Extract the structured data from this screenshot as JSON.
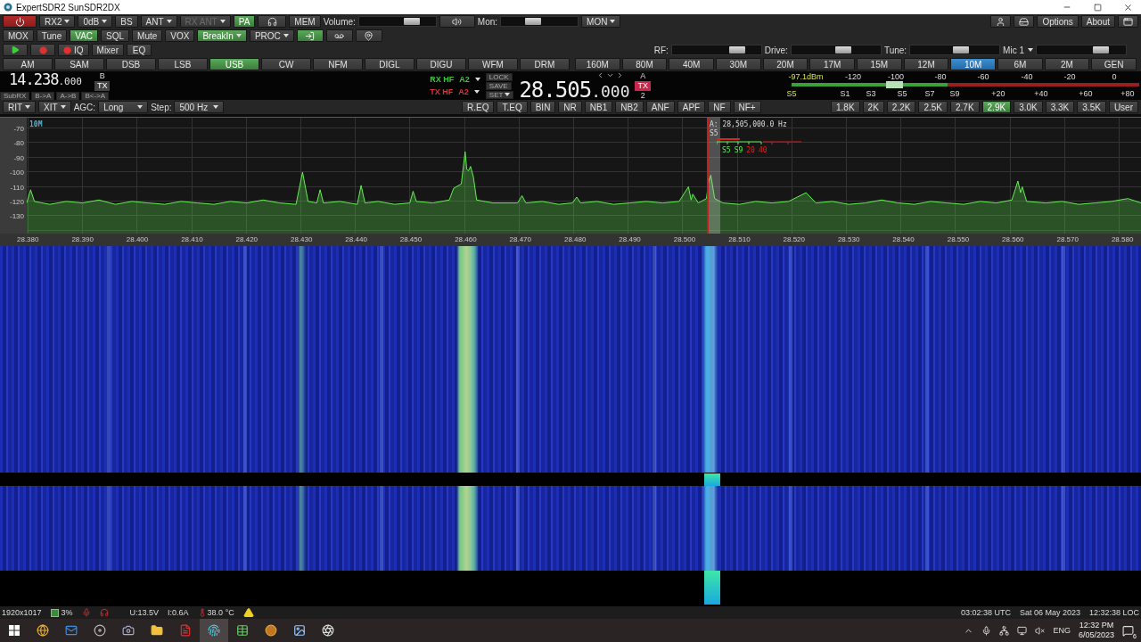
{
  "window": {
    "title": "ExpertSDR2 SunSDR2DX"
  },
  "top_row": [
    {
      "kind": "power"
    },
    {
      "kind": "text",
      "label": "RX2",
      "dropdown": true,
      "selected": false,
      "disabled": false
    },
    {
      "kind": "text",
      "label": "0dB",
      "dropdown": true,
      "selected": false,
      "disabled": false
    },
    {
      "kind": "text",
      "label": "BS",
      "dropdown": false,
      "selected": false,
      "disabled": false
    },
    {
      "kind": "text",
      "label": "ANT",
      "dropdown": true,
      "selected": false,
      "disabled": false
    },
    {
      "kind": "text",
      "label": "RX ANT",
      "dropdown": true,
      "selected": false,
      "disabled": true
    },
    {
      "kind": "text",
      "label": "PA",
      "dropdown": false,
      "selected": true,
      "disabled": false
    },
    {
      "kind": "headphones",
      "selected": false,
      "disabled": false
    },
    {
      "kind": "text",
      "label": "MEM",
      "dropdown": false,
      "selected": false,
      "disabled": false
    },
    {
      "kind": "slider",
      "label": "Volume:",
      "level": 0.74
    },
    {
      "kind": "speaker",
      "selected": false,
      "disabled": false
    },
    {
      "kind": "slider",
      "label": "Mon:",
      "level": 0.4
    },
    {
      "kind": "text",
      "label": "MON",
      "dropdown": true,
      "selected": false,
      "disabled": false
    }
  ],
  "top_row_right": [
    {
      "kind": "user"
    },
    {
      "kind": "drive"
    },
    {
      "kind": "text",
      "label": "Options"
    },
    {
      "kind": "text",
      "label": "About"
    },
    {
      "kind": "window"
    }
  ],
  "second_row": [
    {
      "kind": "text",
      "label": "MOX",
      "dropdown": false,
      "selected": false
    },
    {
      "kind": "text",
      "label": "Tune",
      "dropdown": false,
      "selected": false
    },
    {
      "kind": "text",
      "label": "VAC",
      "dropdown": false,
      "selected": true
    },
    {
      "kind": "text",
      "label": "SQL",
      "dropdown": false,
      "selected": false
    },
    {
      "kind": "text",
      "label": "Mute",
      "dropdown": false,
      "selected": false
    },
    {
      "kind": "text",
      "label": "VOX",
      "dropdown": false,
      "selected": false
    },
    {
      "kind": "text",
      "label": "BreakIn",
      "dropdown": true,
      "selected": true
    },
    {
      "kind": "text",
      "label": "PROC",
      "dropdown": true,
      "selected": false
    },
    {
      "kind": "return",
      "selected": true
    },
    {
      "kind": "tape",
      "selected": false
    },
    {
      "kind": "pin",
      "selected": false
    }
  ],
  "third_row": [
    {
      "kind": "play",
      "selected": false
    },
    {
      "kind": "record",
      "selected": false
    },
    {
      "kind": "record-text",
      "label": "IQ",
      "selected": false
    },
    {
      "kind": "text",
      "label": "Mixer",
      "selected": false
    },
    {
      "kind": "text",
      "label": "EQ",
      "selected": false
    }
  ],
  "level_controls": [
    {
      "label": "RF:",
      "level": 0.78
    },
    {
      "label": "Drive:",
      "level": 0.6
    },
    {
      "label": "Tune:",
      "level": 0.59
    },
    {
      "label": "Mic 1",
      "dropdown": true,
      "level": 0.77
    }
  ],
  "modes": [
    {
      "label": "AM",
      "selected": false
    },
    {
      "label": "SAM",
      "selected": false
    },
    {
      "label": "DSB",
      "selected": false
    },
    {
      "label": "LSB",
      "selected": false
    },
    {
      "label": "USB",
      "selected": true
    },
    {
      "label": "CW",
      "selected": false
    },
    {
      "label": "NFM",
      "selected": false
    },
    {
      "label": "DIGL",
      "selected": false
    },
    {
      "label": "DIGU",
      "selected": false
    },
    {
      "label": "WFM",
      "selected": false
    },
    {
      "label": "DRM",
      "selected": false
    }
  ],
  "bands": [
    {
      "label": "160M",
      "selected": false
    },
    {
      "label": "80M",
      "selected": false
    },
    {
      "label": "40M",
      "selected": false
    },
    {
      "label": "30M",
      "selected": false
    },
    {
      "label": "20M",
      "selected": false
    },
    {
      "label": "17M",
      "selected": false
    },
    {
      "label": "15M",
      "selected": false
    },
    {
      "label": "12M",
      "selected": false
    },
    {
      "label": "10M",
      "selected": true
    },
    {
      "label": "6M",
      "selected": false
    },
    {
      "label": "2M",
      "selected": false
    },
    {
      "label": "GEN",
      "selected": false
    }
  ],
  "vfo_b": {
    "frequency": "14.238",
    "frequency_fine": ".000",
    "label": "B",
    "tx": "TX",
    "buttons": [
      "SubRX",
      "B->A",
      "A->B",
      "B<->A"
    ]
  },
  "rx_path": [
    {
      "label": "RX HF",
      "antenna": "A2",
      "color": "#3ec43e"
    },
    {
      "label": "TX HF",
      "antenna": "A2",
      "color": "#e0303a"
    }
  ],
  "memory_buttons": [
    {
      "label": "LOCK",
      "dropdown": false
    },
    {
      "label": "SAVE",
      "dropdown": false
    },
    {
      "label": "SET",
      "dropdown": true
    }
  ],
  "vfo_a": {
    "frequency": "28.505",
    "frequency_fine": ".000",
    "label": "A",
    "tx": "TX",
    "receiver": "2"
  },
  "s_meter": {
    "reading": "-97.1dBm",
    "s_reading": "S5",
    "level": 0.32,
    "dbm_scale": [
      "-120",
      "-100",
      "-80",
      "-60",
      "-40",
      "-20",
      "0"
    ],
    "s_scale": [
      "S1",
      "S3",
      "S5",
      "S7",
      "S9",
      "+20",
      "+40",
      "+60",
      "+80"
    ]
  },
  "receiver_controls": [
    {
      "kind": "dropdown",
      "label": "RIT"
    },
    {
      "kind": "dropdown",
      "label": "XIT"
    },
    {
      "kind": "select",
      "label": "AGC:",
      "value": "Long"
    },
    {
      "kind": "select",
      "label": "Step:",
      "value": "500 Hz"
    }
  ],
  "dsp_buttons": [
    {
      "label": "R.EQ",
      "selected": false
    },
    {
      "label": "T.EQ",
      "selected": false
    },
    {
      "label": "BIN",
      "selected": false
    },
    {
      "label": "NR",
      "selected": false
    },
    {
      "label": "NB1",
      "selected": false
    },
    {
      "label": "NB2",
      "selected": false
    },
    {
      "label": "ANF",
      "selected": false
    },
    {
      "label": "APF",
      "selected": false
    },
    {
      "label": "NF",
      "selected": false
    },
    {
      "label": "NF+",
      "selected": false
    }
  ],
  "filters": [
    {
      "label": "1.8K",
      "selected": false
    },
    {
      "label": "2K",
      "selected": false
    },
    {
      "label": "2.2K",
      "selected": false
    },
    {
      "label": "2.5K",
      "selected": false
    },
    {
      "label": "2.7K",
      "selected": false
    },
    {
      "label": "2.9K",
      "selected": true
    },
    {
      "label": "3.0K",
      "selected": false
    },
    {
      "label": "3.3K",
      "selected": false
    },
    {
      "label": "3.5K",
      "selected": false
    },
    {
      "label": "User",
      "selected": false
    }
  ],
  "spectrum": {
    "band_label": "10M",
    "chart_data": {
      "type": "area",
      "xlim": [
        28.3798,
        28.5834
      ],
      "ylim": [
        -142,
        -62.7
      ],
      "ref_lines": [
        {
          "axis": "x",
          "value": 28.5043,
          "color": "#c02020"
        }
      ],
      "bands": [
        {
          "axis": "x",
          "from": 28.5044,
          "to": 28.5066,
          "color": "#bebebe"
        }
      ],
      "yticks": [
        -70,
        -80,
        -90,
        -100,
        -110,
        -120,
        -130
      ],
      "xticks": [
        {
          "value": 28.38,
          "label": "28.380"
        },
        {
          "value": 28.39,
          "label": "28.390"
        },
        {
          "value": 28.4,
          "label": "28.400"
        },
        {
          "value": 28.41,
          "label": "28.410"
        },
        {
          "value": 28.42,
          "label": "28.420"
        },
        {
          "value": 28.43,
          "label": "28.430"
        },
        {
          "value": 28.44,
          "label": "28.440"
        },
        {
          "value": 28.45,
          "label": "28.450"
        },
        {
          "value": 28.46,
          "label": "28.460"
        },
        {
          "value": 28.47,
          "label": "28.470"
        },
        {
          "value": 28.48,
          "label": "28.480"
        },
        {
          "value": 28.49,
          "label": "28.490"
        },
        {
          "value": 28.5,
          "label": "28.500"
        },
        {
          "value": 28.51,
          "label": "28.510"
        },
        {
          "value": 28.52,
          "label": "28.520"
        },
        {
          "value": 28.53,
          "label": "28.530"
        },
        {
          "value": 28.54,
          "label": "28.540"
        },
        {
          "value": 28.55,
          "label": "28.550"
        },
        {
          "value": 28.56,
          "label": "28.560"
        },
        {
          "value": 28.57,
          "label": "28.570"
        },
        {
          "value": 28.58,
          "label": "28.580"
        }
      ],
      "x": [
        28.3798,
        28.3805,
        28.3812,
        28.384,
        28.387,
        28.39,
        28.393,
        28.396,
        28.399,
        28.402,
        28.405,
        28.408,
        28.411,
        28.414,
        28.417,
        28.42,
        28.423,
        28.426,
        28.429,
        28.4302,
        28.4312,
        28.4328,
        28.4334,
        28.434,
        28.437,
        28.4402,
        28.4409,
        28.4416,
        28.444,
        28.447,
        28.4498,
        28.4504,
        28.451,
        28.454,
        28.457,
        28.4578,
        28.4592,
        28.4599,
        28.4602,
        28.4605,
        28.4609,
        28.4614,
        28.462,
        28.465,
        28.4695,
        28.4703,
        28.471,
        28.474,
        28.477,
        28.4795,
        28.4803,
        28.481,
        28.484,
        28.487,
        28.49,
        28.493,
        28.496,
        28.499,
        28.5007,
        28.5012,
        28.5015,
        28.5025,
        28.504,
        28.5044,
        28.5048,
        28.5055,
        28.507,
        28.51,
        28.513,
        28.516,
        28.519,
        28.5222,
        28.524,
        28.527,
        28.53,
        28.533,
        28.536,
        28.539,
        28.542,
        28.545,
        28.548,
        28.551,
        28.554,
        28.557,
        28.5598,
        28.5604,
        28.5609,
        28.5614,
        28.5617,
        28.5625,
        28.566,
        28.569,
        28.572,
        28.575,
        28.578,
        28.581,
        28.5834
      ],
      "series": [
        {
          "color": "#66ee55",
          "values": [
            -121,
            -112,
            -120,
            -122,
            -120,
            -121,
            -119,
            -122,
            -120,
            -121,
            -122,
            -120,
            -121,
            -122,
            -120,
            -121,
            -119,
            -121,
            -122,
            -100,
            -120,
            -121,
            -112,
            -121,
            -120,
            -122,
            -109,
            -121,
            -120,
            -122,
            -121,
            -113,
            -120,
            -121,
            -119,
            -111,
            -108,
            -86,
            -98,
            -99,
            -96,
            -103,
            -119,
            -121,
            -121,
            -116,
            -121,
            -120,
            -122,
            -121,
            -117,
            -121,
            -120,
            -122,
            -121,
            -120,
            -121,
            -120,
            -110,
            -119,
            -115,
            -121,
            -118,
            -106,
            -102,
            -118,
            -121,
            -122,
            -120,
            -121,
            -120,
            -114,
            -121,
            -120,
            -122,
            -121,
            -119,
            -121,
            -122,
            -120,
            -121,
            -122,
            -120,
            -121,
            -119,
            -112,
            -106,
            -114,
            -110,
            -120,
            -121,
            -120,
            -122,
            -121,
            -120,
            -118,
            -121
          ]
        }
      ]
    },
    "marker": {
      "readout": "A: 28,505,000.0 Hz",
      "s_reading": "S5",
      "scale": [
        "S5",
        "S9",
        "20",
        "40"
      ]
    }
  },
  "status_bar": {
    "resolution": "1920x1017",
    "cpu": "3%",
    "voltage": "U:13.5V",
    "current": "I:0.6A",
    "temperature": "38.0 °C",
    "utc": "03:02:38 UTC",
    "date": "Sat 06 May 2023",
    "local_time": "12:32:38 LOC"
  },
  "taskbar": {
    "apps": [
      {
        "kind": "globe",
        "selected": false
      },
      {
        "kind": "mail",
        "selected": false
      },
      {
        "kind": "disc",
        "selected": false
      },
      {
        "kind": "camera",
        "selected": false
      },
      {
        "kind": "folder",
        "selected": false
      },
      {
        "kind": "document",
        "selected": false
      },
      {
        "kind": "fingerprint",
        "selected": true
      },
      {
        "kind": "table",
        "selected": false
      },
      {
        "kind": "badge",
        "selected": false
      },
      {
        "kind": "image",
        "selected": false
      },
      {
        "kind": "aperture",
        "selected": false
      }
    ],
    "language": "ENG",
    "time": "12:32 PM",
    "date": "6/05/2023",
    "notifications": "6"
  }
}
